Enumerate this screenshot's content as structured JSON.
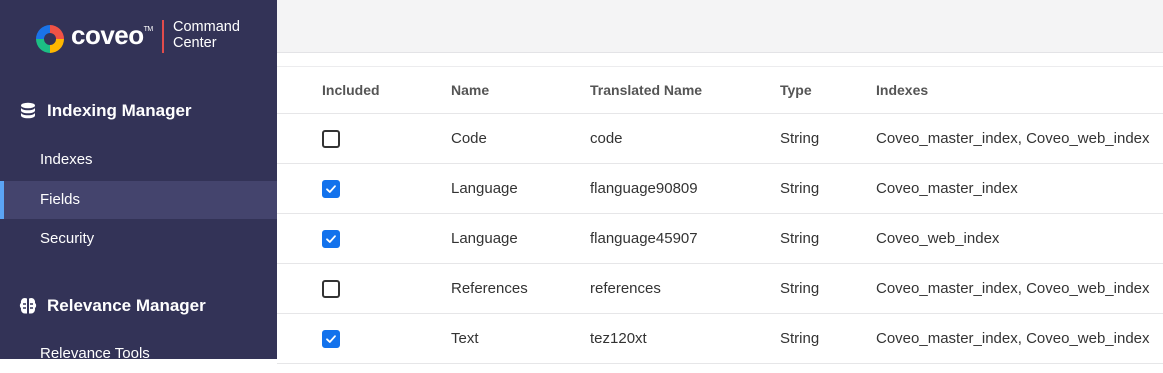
{
  "brand": {
    "word": "coveo",
    "tm": "TM",
    "sub_line1": "Command",
    "sub_line2": "Center"
  },
  "sidebar": {
    "sections": [
      {
        "title": "Indexing Manager",
        "icon": "database-icon",
        "items": [
          {
            "label": "Indexes",
            "active": false
          },
          {
            "label": "Fields",
            "active": true
          },
          {
            "label": "Security",
            "active": false
          }
        ]
      },
      {
        "title": "Relevance Manager",
        "icon": "brain-icon",
        "items": [
          {
            "label": "Relevance Tools",
            "active": false
          }
        ]
      }
    ]
  },
  "table": {
    "headers": [
      "Included",
      "Name",
      "Translated Name",
      "Type",
      "Indexes"
    ],
    "rows": [
      {
        "included": false,
        "name": "Code",
        "translated": "code",
        "type": "String",
        "indexes": "Coveo_master_index, Coveo_web_index"
      },
      {
        "included": true,
        "name": "Language",
        "translated": "flanguage90809",
        "type": "String",
        "indexes": "Coveo_master_index"
      },
      {
        "included": true,
        "name": "Language",
        "translated": "flanguage45907",
        "type": "String",
        "indexes": "Coveo_web_index"
      },
      {
        "included": false,
        "name": "References",
        "translated": "references",
        "type": "String",
        "indexes": "Coveo_master_index, Coveo_web_index"
      },
      {
        "included": true,
        "name": "Text",
        "translated": "tez120xt",
        "type": "String",
        "indexes": "Coveo_master_index, Coveo_web_index"
      }
    ]
  },
  "colors": {
    "sidebar": "#333357",
    "active_item": "#44446d",
    "accent": "#1372ec",
    "divider": "#e14c4c"
  }
}
